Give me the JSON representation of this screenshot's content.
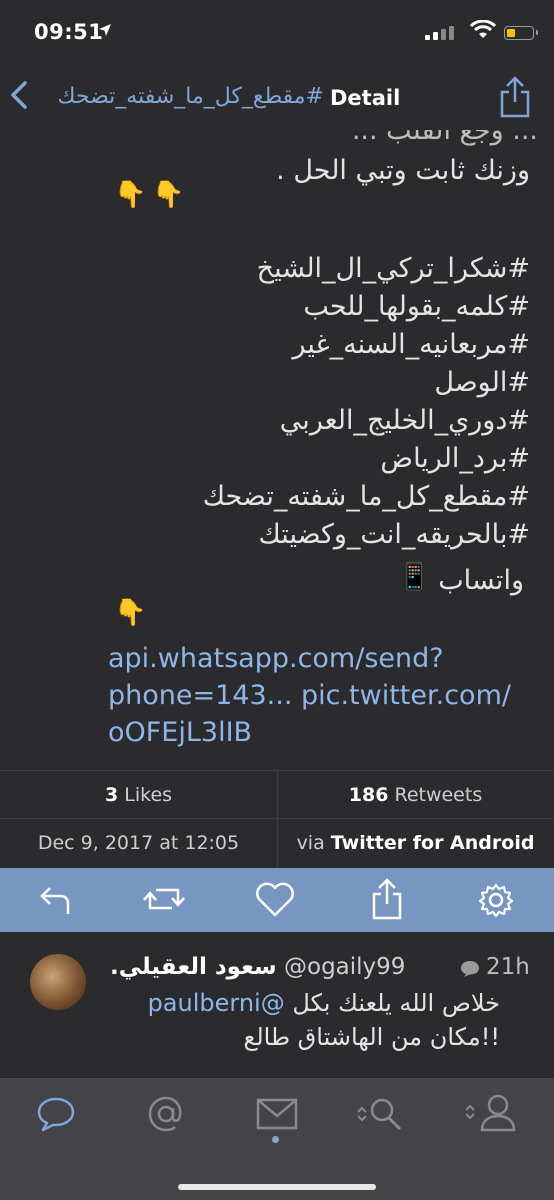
{
  "status_bar": {
    "time": "09:51",
    "colors": {
      "battery": "#f0c20b"
    }
  },
  "nav": {
    "back_title": "#مقطع_كل_ما_شفته_تضحك",
    "title": "Detail"
  },
  "tweet": {
    "partial_line": "... وجع القلب ...",
    "lines": [
      "وزنك ثابت وتبي الحل .",
      "#شكرا_تركي_ال_الشيخ",
      "#كلمه_بقولها_للحب",
      "#مربعانيه_السنه_غير",
      "#الوصل",
      "#دوري_الخليج_العربي",
      "#برد_الرياض",
      "#مقطع_كل_ما_شفته_تضحك",
      "#بالحريقه_انت_وكضيتك",
      "واتساب"
    ],
    "emoji_point": "👇",
    "emoji_phone": "📱",
    "links": [
      "api.whatsapp.com/send?",
      "phone=143... pic.twitter.com/",
      "oOFEjL3lIB"
    ]
  },
  "stats": {
    "likes_count": "3",
    "likes_label": "Likes",
    "retweets_count": "186",
    "retweets_label": "Retweets",
    "date": "Dec 9, 2017 at 12:05",
    "via_label": "via",
    "via_app": "Twitter for Android"
  },
  "actions": {
    "icons": [
      "reply-icon",
      "retweet-icon",
      "like-icon",
      "share-icon",
      "settings-icon"
    ],
    "color": "#7896c2"
  },
  "reply": {
    "name": "سعود العقيلي.",
    "handle": "@ogaily99",
    "time": "21h",
    "mention": "@paulberni",
    "text_line1": "خلاص الله يلعنك بكل",
    "text_line2": "!!مكان من الهاشتاق طالع"
  },
  "tabbar": {
    "tabs": [
      "messages-icon",
      "mentions-icon",
      "inbox-icon",
      "search-icon",
      "profile-icon"
    ]
  }
}
